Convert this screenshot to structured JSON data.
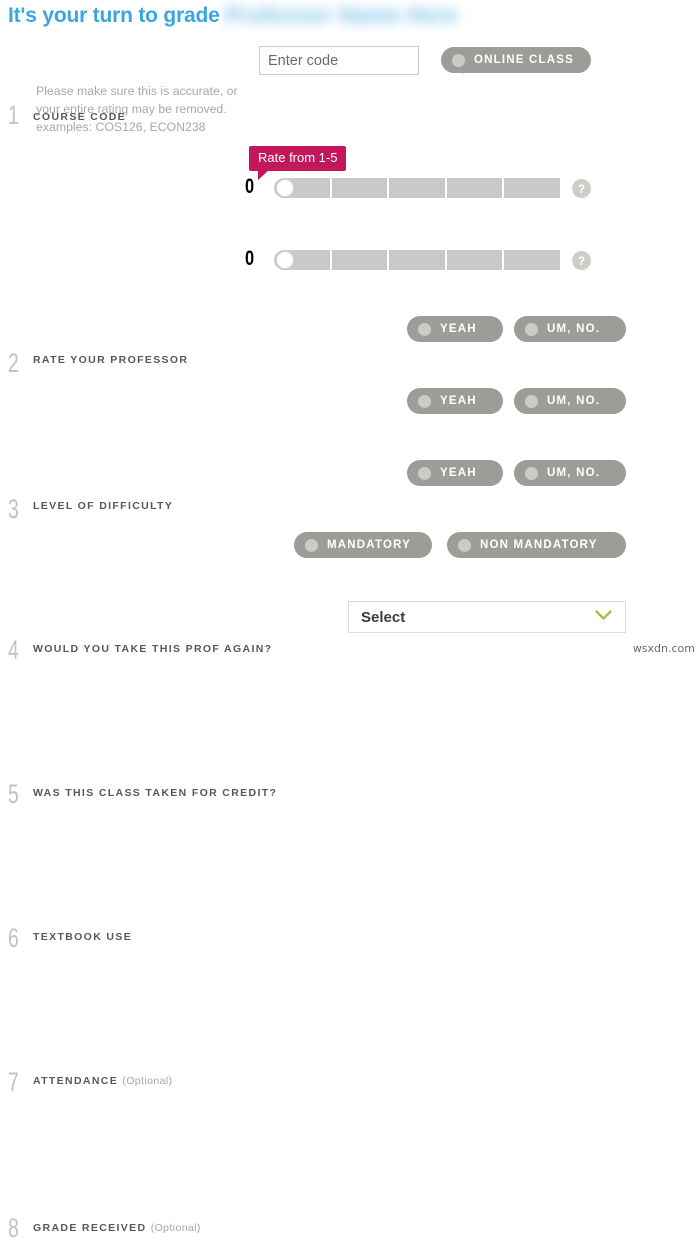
{
  "header": {
    "title_prefix": "It's your turn to grade",
    "professor_name": "Professor Name Here"
  },
  "steps": [
    {
      "number": "1",
      "label": "COURSE CODE",
      "optional": "",
      "helper": "Please make sure this is accurate, or\nyour entire rating may be removed.\nexamples: COS126, ECON238"
    },
    {
      "number": "2",
      "label": "RATE YOUR PROFESSOR",
      "optional": ""
    },
    {
      "number": "3",
      "label": "LEVEL OF DIFFICULTY",
      "optional": ""
    },
    {
      "number": "4",
      "label": "WOULD YOU TAKE THIS PROF AGAIN?",
      "optional": ""
    },
    {
      "number": "5",
      "label": "WAS THIS CLASS TAKEN FOR CREDIT?",
      "optional": ""
    },
    {
      "number": "6",
      "label": "TEXTBOOK USE",
      "optional": ""
    },
    {
      "number": "7",
      "label": "ATTENDANCE",
      "optional": "(Optional)"
    },
    {
      "number": "8",
      "label": "GRADE RECEIVED",
      "optional": "(Optional)"
    }
  ],
  "course_code": {
    "placeholder": "Enter code",
    "value": "",
    "submit_icon": "enter-arrow-icon"
  },
  "online_class": {
    "label": "ONLINE CLASS"
  },
  "rating": {
    "value": "0",
    "tooltip": "Rate from 1-5",
    "segments": 5,
    "help_glyph": "?"
  },
  "difficulty": {
    "value": "0",
    "segments": 5,
    "help_glyph": "?"
  },
  "yes_no": {
    "yes_label": "YEAH",
    "no_label": "UM, NO."
  },
  "attendance": {
    "mandatory_label": "MANDATORY",
    "non_mandatory_label": "NON MANDATORY"
  },
  "grade": {
    "selected": "Select",
    "chevron_icon": "chevron-down-icon"
  },
  "watermark": "wsxdn.com",
  "colors": {
    "title_blue": "#3aa6dd",
    "pill_gray": "#9c9c98",
    "tooltip_magenta": "#c2185b",
    "chevron_green": "#a8bd4e",
    "slider_track": "#c9c9c9"
  }
}
